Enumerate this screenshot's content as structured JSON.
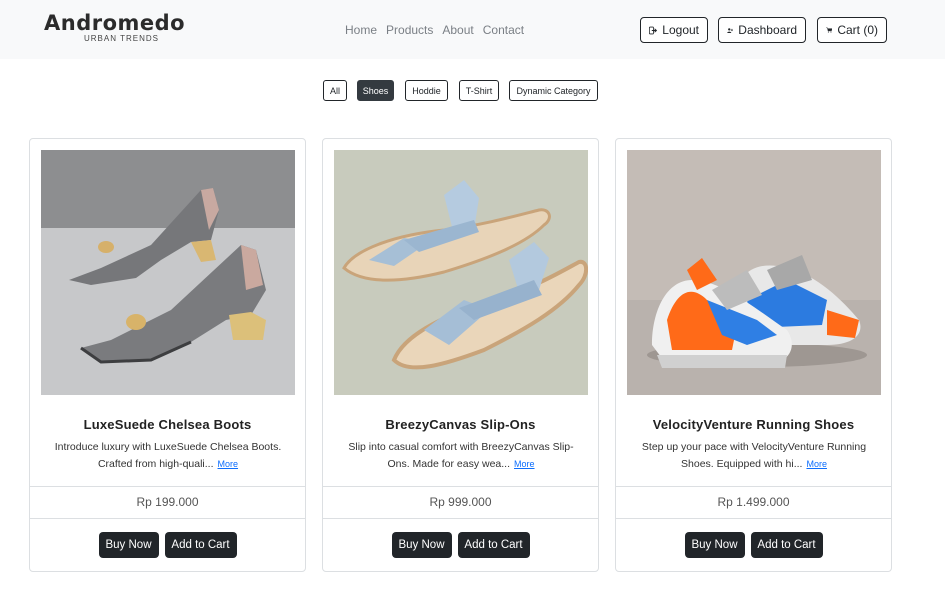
{
  "brand": {
    "name": "Andromedo",
    "tagline": "URBAN TRENDS"
  },
  "nav": {
    "links": [
      "Home",
      "Products",
      "About",
      "Contact"
    ],
    "logout_label": "Logout",
    "dashboard_label": "Dashboard",
    "cart_label": "Cart (0)"
  },
  "filters": {
    "items": [
      "All",
      "Shoes",
      "Hoddie",
      "T-Shirt",
      "Dynamic Category"
    ],
    "active": "Shoes"
  },
  "products": [
    {
      "title": "LuxeSuede Chelsea Boots",
      "description": "Introduce luxury with LuxeSuede Chelsea Boots. Crafted from high-quali...",
      "more_label": "More",
      "price": "Rp 199.000",
      "buy_label": "Buy Now",
      "add_label": "Add to Cart",
      "image_icon": "gray-heeled-sandals-image"
    },
    {
      "title": "BreezyCanvas Slip-Ons",
      "description": "Slip into casual comfort with BreezyCanvas Slip-Ons. Made for easy wea...",
      "more_label": "More",
      "price": "Rp 999.000",
      "buy_label": "Buy Now",
      "add_label": "Add to Cart",
      "image_icon": "denim-strap-sandals-image"
    },
    {
      "title": "VelocityVenture Running Shoes",
      "description": "Step up your pace with VelocityVenture Running Shoes. Equipped with hi...",
      "more_label": "More",
      "price": "Rp 1.499.000",
      "buy_label": "Buy Now",
      "add_label": "Add to Cart",
      "image_icon": "orange-blue-sneakers-image"
    }
  ],
  "colors": {
    "navbar_bg": "#f8f9fa",
    "primary_dark": "#212529",
    "link_blue": "#0d6efd"
  }
}
